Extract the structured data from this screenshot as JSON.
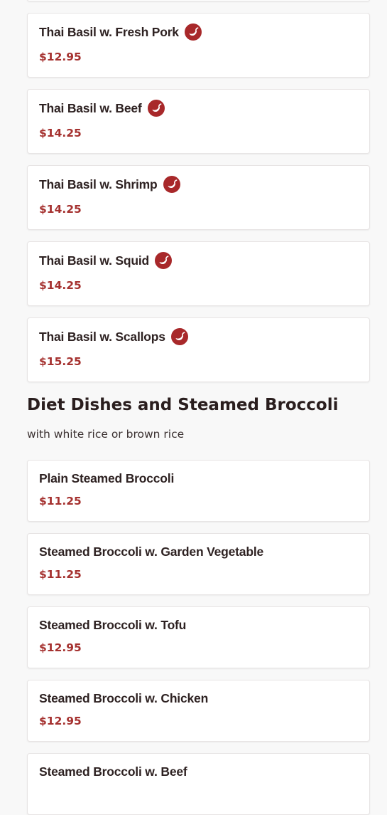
{
  "colors": {
    "page_background": "#f8f8f8",
    "card_background": "#ffffff",
    "price": "#a5312f",
    "spicy_icon": "#a8282a",
    "text": "#2e2222"
  },
  "spicy_icon": "chili-pepper-icon",
  "thai_basil_items": [
    {
      "name": "Thai Basil w. Fresh Pork",
      "price": "$12.95",
      "spicy": true
    },
    {
      "name": "Thai Basil w. Beef",
      "price": "$14.25",
      "spicy": true
    },
    {
      "name": "Thai Basil w. Shrimp",
      "price": "$14.25",
      "spicy": true
    },
    {
      "name": "Thai Basil w. Squid",
      "price": "$14.25",
      "spicy": true
    },
    {
      "name": "Thai Basil w. Scallops",
      "price": "$15.25",
      "spicy": true
    }
  ],
  "diet_section": {
    "title": "Diet Dishes and Steamed Broccoli",
    "subtitle": "with white rice or brown rice",
    "items": [
      {
        "name": "Plain Steamed Broccoli",
        "price": "$11.25",
        "spicy": false
      },
      {
        "name": "Steamed Broccoli w. Garden Vegetable",
        "price": "$11.25",
        "spicy": false
      },
      {
        "name": "Steamed Broccoli w. Tofu",
        "price": "$12.95",
        "spicy": false
      },
      {
        "name": "Steamed Broccoli w. Chicken",
        "price": "$12.95",
        "spicy": false
      },
      {
        "name": "Steamed Broccoli w. Beef",
        "price": "",
        "spicy": false
      }
    ]
  }
}
